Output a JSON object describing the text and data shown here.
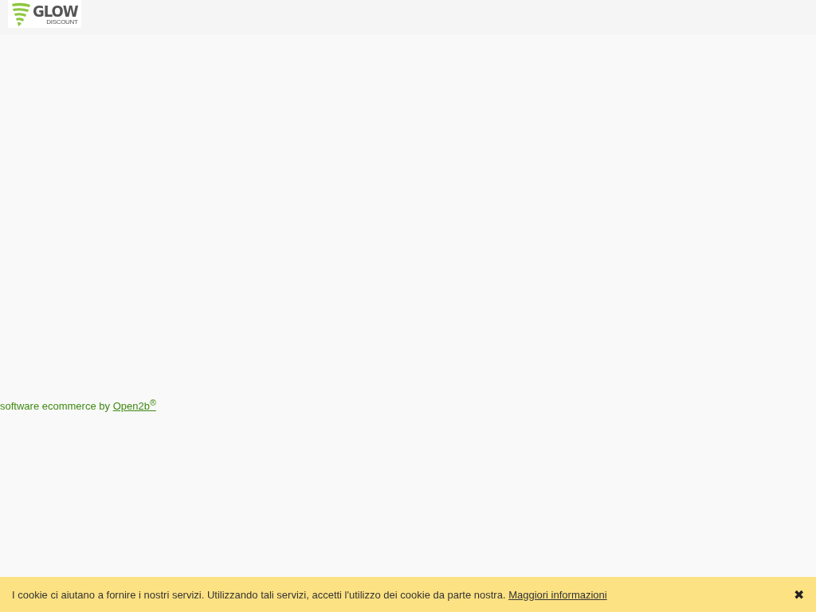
{
  "header": {
    "logo": {
      "word": "GLOW",
      "subword": "DISCOUNT"
    }
  },
  "footer": {
    "text": "software ecommerce by",
    "link": "Open2b",
    "mark": "®"
  },
  "cookie_bar": {
    "text": "I cookie ci aiutano a fornire i nostri servizi. Utilizzando tali servizi, accetti l'utilizzo dei cookie da parte nostra.",
    "link": "Maggiori informazioni",
    "close": "✖"
  }
}
